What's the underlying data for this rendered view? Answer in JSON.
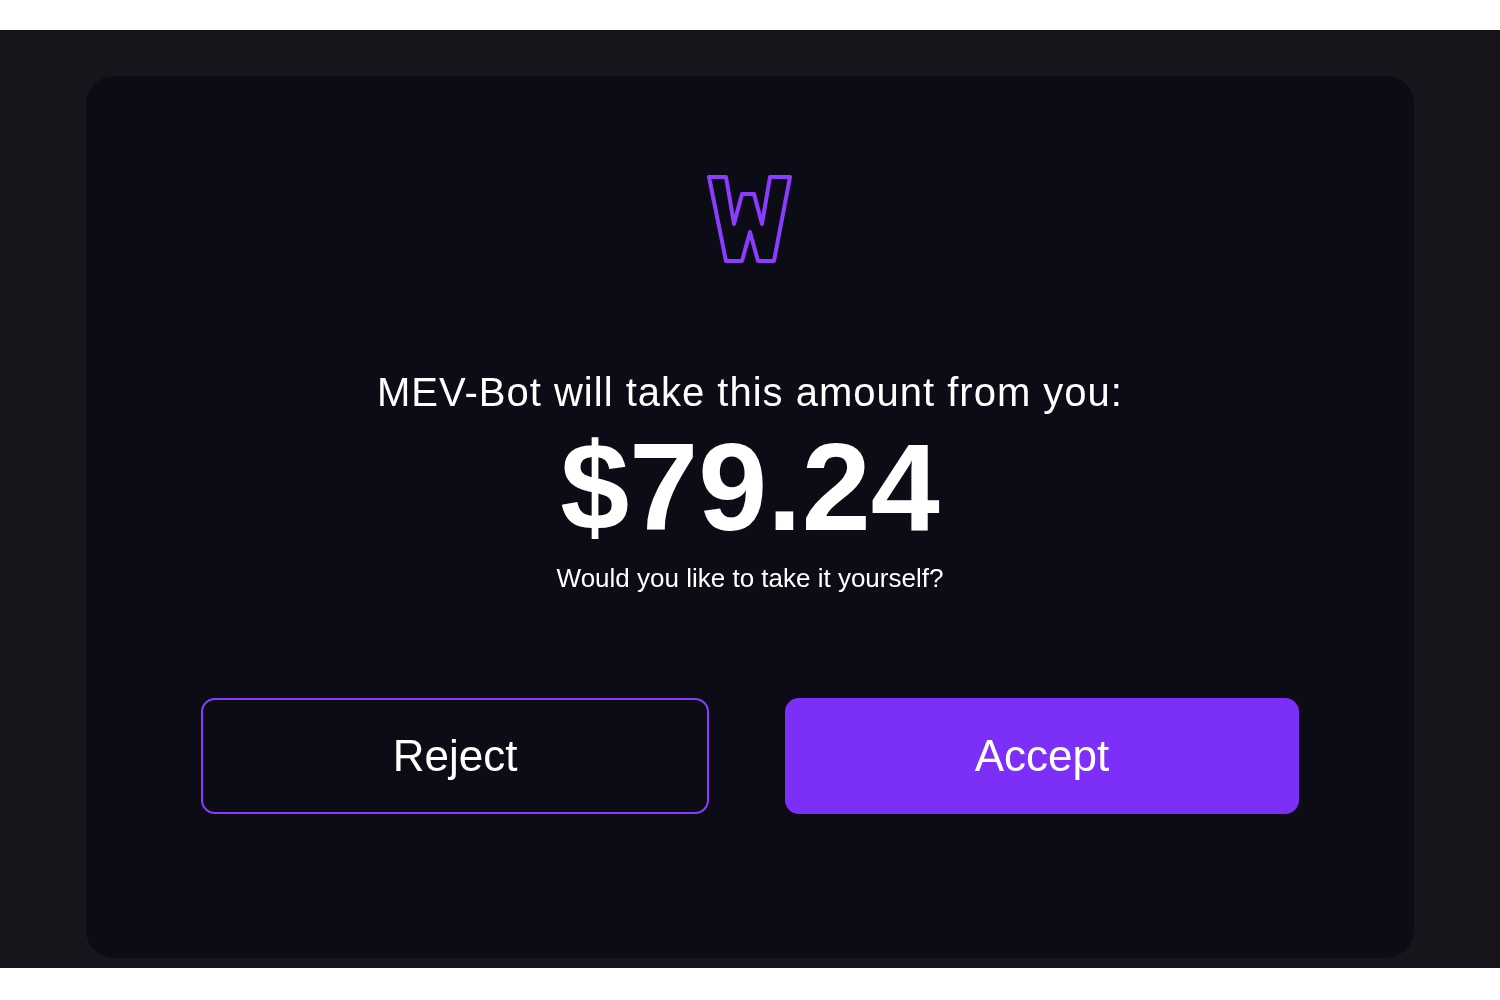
{
  "dialog": {
    "message": "MEV-Bot will take this amount from you:",
    "amount": "$79.24",
    "question": "Would you like to take it yourself?"
  },
  "buttons": [
    {
      "label": "Reject",
      "kind": "outline"
    },
    {
      "label": "Accept",
      "kind": "primary"
    }
  ]
}
